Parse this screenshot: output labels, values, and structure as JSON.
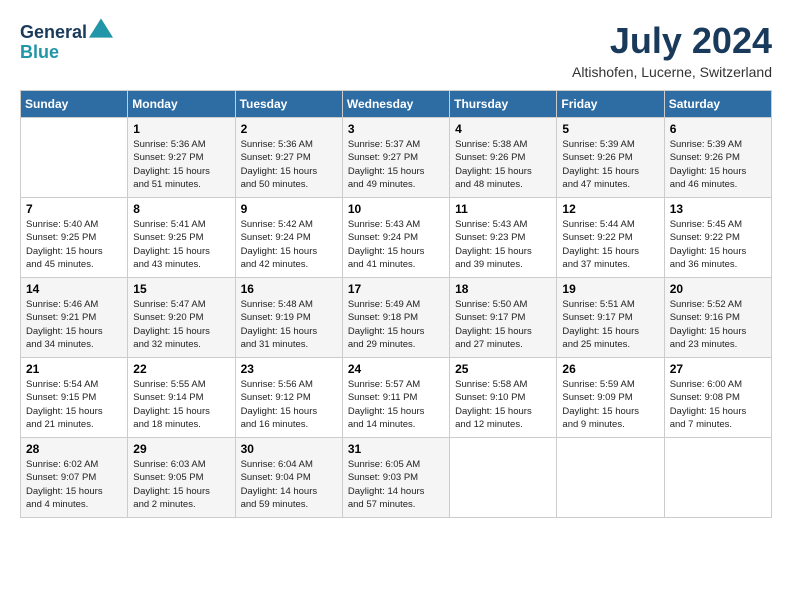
{
  "header": {
    "logo_line1": "General",
    "logo_line2": "Blue",
    "month": "July 2024",
    "location": "Altishofen, Lucerne, Switzerland"
  },
  "weekdays": [
    "Sunday",
    "Monday",
    "Tuesday",
    "Wednesday",
    "Thursday",
    "Friday",
    "Saturday"
  ],
  "weeks": [
    [
      {
        "day": "",
        "info": ""
      },
      {
        "day": "1",
        "info": "Sunrise: 5:36 AM\nSunset: 9:27 PM\nDaylight: 15 hours\nand 51 minutes."
      },
      {
        "day": "2",
        "info": "Sunrise: 5:36 AM\nSunset: 9:27 PM\nDaylight: 15 hours\nand 50 minutes."
      },
      {
        "day": "3",
        "info": "Sunrise: 5:37 AM\nSunset: 9:27 PM\nDaylight: 15 hours\nand 49 minutes."
      },
      {
        "day": "4",
        "info": "Sunrise: 5:38 AM\nSunset: 9:26 PM\nDaylight: 15 hours\nand 48 minutes."
      },
      {
        "day": "5",
        "info": "Sunrise: 5:39 AM\nSunset: 9:26 PM\nDaylight: 15 hours\nand 47 minutes."
      },
      {
        "day": "6",
        "info": "Sunrise: 5:39 AM\nSunset: 9:26 PM\nDaylight: 15 hours\nand 46 minutes."
      }
    ],
    [
      {
        "day": "7",
        "info": "Sunrise: 5:40 AM\nSunset: 9:25 PM\nDaylight: 15 hours\nand 45 minutes."
      },
      {
        "day": "8",
        "info": "Sunrise: 5:41 AM\nSunset: 9:25 PM\nDaylight: 15 hours\nand 43 minutes."
      },
      {
        "day": "9",
        "info": "Sunrise: 5:42 AM\nSunset: 9:24 PM\nDaylight: 15 hours\nand 42 minutes."
      },
      {
        "day": "10",
        "info": "Sunrise: 5:43 AM\nSunset: 9:24 PM\nDaylight: 15 hours\nand 41 minutes."
      },
      {
        "day": "11",
        "info": "Sunrise: 5:43 AM\nSunset: 9:23 PM\nDaylight: 15 hours\nand 39 minutes."
      },
      {
        "day": "12",
        "info": "Sunrise: 5:44 AM\nSunset: 9:22 PM\nDaylight: 15 hours\nand 37 minutes."
      },
      {
        "day": "13",
        "info": "Sunrise: 5:45 AM\nSunset: 9:22 PM\nDaylight: 15 hours\nand 36 minutes."
      }
    ],
    [
      {
        "day": "14",
        "info": "Sunrise: 5:46 AM\nSunset: 9:21 PM\nDaylight: 15 hours\nand 34 minutes."
      },
      {
        "day": "15",
        "info": "Sunrise: 5:47 AM\nSunset: 9:20 PM\nDaylight: 15 hours\nand 32 minutes."
      },
      {
        "day": "16",
        "info": "Sunrise: 5:48 AM\nSunset: 9:19 PM\nDaylight: 15 hours\nand 31 minutes."
      },
      {
        "day": "17",
        "info": "Sunrise: 5:49 AM\nSunset: 9:18 PM\nDaylight: 15 hours\nand 29 minutes."
      },
      {
        "day": "18",
        "info": "Sunrise: 5:50 AM\nSunset: 9:17 PM\nDaylight: 15 hours\nand 27 minutes."
      },
      {
        "day": "19",
        "info": "Sunrise: 5:51 AM\nSunset: 9:17 PM\nDaylight: 15 hours\nand 25 minutes."
      },
      {
        "day": "20",
        "info": "Sunrise: 5:52 AM\nSunset: 9:16 PM\nDaylight: 15 hours\nand 23 minutes."
      }
    ],
    [
      {
        "day": "21",
        "info": "Sunrise: 5:54 AM\nSunset: 9:15 PM\nDaylight: 15 hours\nand 21 minutes."
      },
      {
        "day": "22",
        "info": "Sunrise: 5:55 AM\nSunset: 9:14 PM\nDaylight: 15 hours\nand 18 minutes."
      },
      {
        "day": "23",
        "info": "Sunrise: 5:56 AM\nSunset: 9:12 PM\nDaylight: 15 hours\nand 16 minutes."
      },
      {
        "day": "24",
        "info": "Sunrise: 5:57 AM\nSunset: 9:11 PM\nDaylight: 15 hours\nand 14 minutes."
      },
      {
        "day": "25",
        "info": "Sunrise: 5:58 AM\nSunset: 9:10 PM\nDaylight: 15 hours\nand 12 minutes."
      },
      {
        "day": "26",
        "info": "Sunrise: 5:59 AM\nSunset: 9:09 PM\nDaylight: 15 hours\nand 9 minutes."
      },
      {
        "day": "27",
        "info": "Sunrise: 6:00 AM\nSunset: 9:08 PM\nDaylight: 15 hours\nand 7 minutes."
      }
    ],
    [
      {
        "day": "28",
        "info": "Sunrise: 6:02 AM\nSunset: 9:07 PM\nDaylight: 15 hours\nand 4 minutes."
      },
      {
        "day": "29",
        "info": "Sunrise: 6:03 AM\nSunset: 9:05 PM\nDaylight: 15 hours\nand 2 minutes."
      },
      {
        "day": "30",
        "info": "Sunrise: 6:04 AM\nSunset: 9:04 PM\nDaylight: 14 hours\nand 59 minutes."
      },
      {
        "day": "31",
        "info": "Sunrise: 6:05 AM\nSunset: 9:03 PM\nDaylight: 14 hours\nand 57 minutes."
      },
      {
        "day": "",
        "info": ""
      },
      {
        "day": "",
        "info": ""
      },
      {
        "day": "",
        "info": ""
      }
    ]
  ]
}
